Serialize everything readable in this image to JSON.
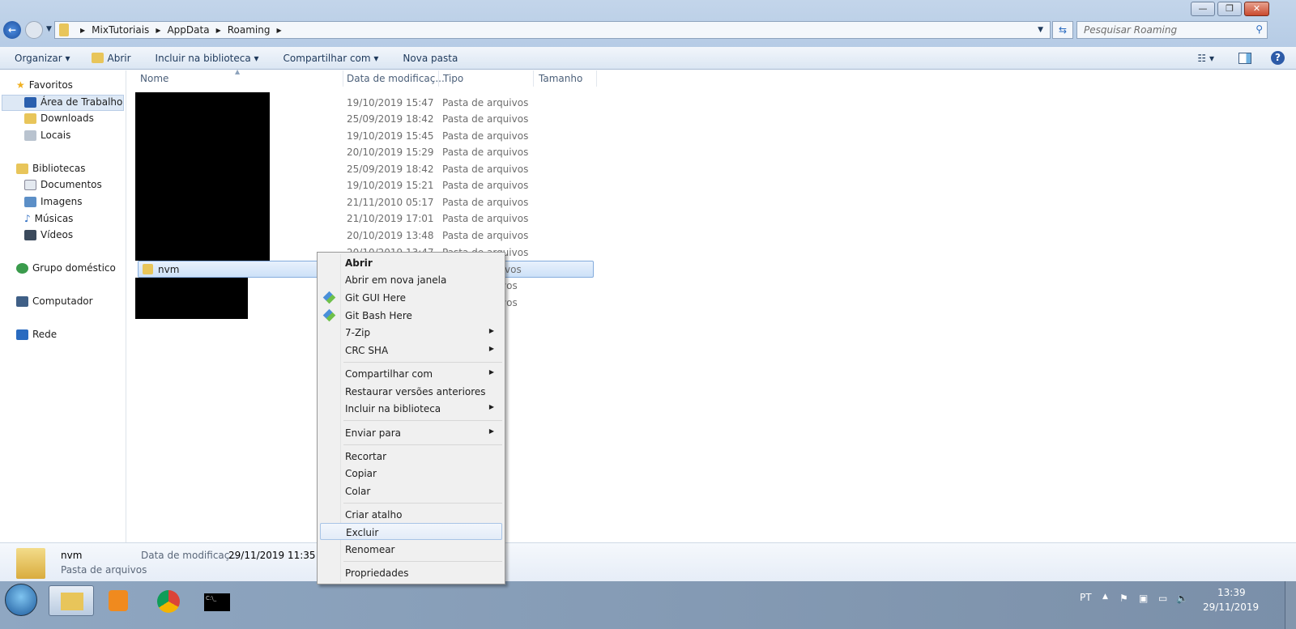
{
  "window": {
    "buttons": {
      "minimize": "—",
      "restore": "❐",
      "close": "✕"
    }
  },
  "address": {
    "crumbs": [
      "MixTutoriais",
      "AppData",
      "Roaming"
    ],
    "search_placeholder": "Pesquisar Roaming"
  },
  "toolbar": {
    "organize": "Organizar ▾",
    "open": "Abrir",
    "library": "Incluir na biblioteca ▾",
    "share": "Compartilhar com ▾",
    "new_folder": "Nova pasta"
  },
  "nav": {
    "favorites": "Favoritos",
    "desktop": "Área de Trabalho",
    "downloads": "Downloads",
    "places": "Locais",
    "libraries": "Bibliotecas",
    "documents": "Documentos",
    "images": "Imagens",
    "music": "Músicas",
    "videos": "Vídeos",
    "homegroup": "Grupo doméstico",
    "computer": "Computador",
    "network": "Rede"
  },
  "columns": {
    "name": "Nome",
    "date": "Data de modificaç...",
    "type": "Tipo",
    "size": "Tamanho"
  },
  "rows": [
    {
      "date": "19/10/2019 15:47",
      "type": "Pasta de arquivos"
    },
    {
      "date": "25/09/2019 18:42",
      "type": "Pasta de arquivos"
    },
    {
      "date": "19/10/2019 15:45",
      "type": "Pasta de arquivos"
    },
    {
      "date": "20/10/2019 15:29",
      "type": "Pasta de arquivos"
    },
    {
      "date": "25/09/2019 18:42",
      "type": "Pasta de arquivos"
    },
    {
      "date": "19/10/2019 15:21",
      "type": "Pasta de arquivos"
    },
    {
      "date": "21/11/2010 05:17",
      "type": "Pasta de arquivos"
    },
    {
      "date": "21/10/2019 17:01",
      "type": "Pasta de arquivos"
    },
    {
      "date": "20/10/2019 13:48",
      "type": "Pasta de arquivos"
    },
    {
      "date": "20/10/2019 13:47",
      "type": "Pasta de arquivos"
    }
  ],
  "selected": {
    "name": "nvm",
    "type_tail": "vos"
  },
  "hidden_rows_tail": [
    "vos",
    "vos"
  ],
  "context_menu": {
    "items": [
      "Abrir",
      "Abrir em nova janela",
      "Git GUI Here",
      "Git Bash Here",
      "7-Zip",
      "CRC SHA",
      "Compartilhar com",
      "Restaurar versões anteriores",
      "Incluir na biblioteca",
      "Enviar para",
      "Recortar",
      "Copiar",
      "Colar",
      "Criar atalho",
      "Excluir",
      "Renomear",
      "Propriedades"
    ],
    "submenu_arrow": "▶",
    "hovered": "Excluir"
  },
  "details": {
    "name": "nvm",
    "date_label": "Data de modificaç...",
    "date": "29/11/2019 11:35",
    "type": "Pasta de arquivos"
  },
  "taskbar": {
    "lang": "PT",
    "time": "13:39",
    "date": "29/11/2019",
    "cmd": "C:\\_"
  }
}
